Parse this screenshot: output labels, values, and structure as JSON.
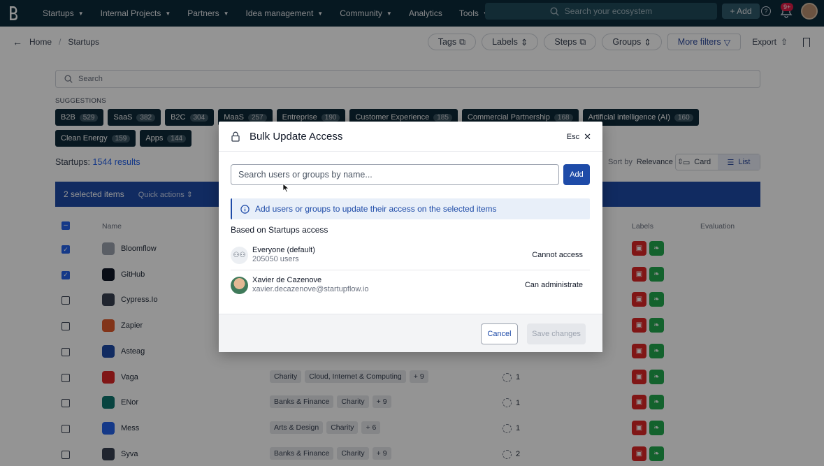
{
  "topnav": {
    "items": [
      "Startups",
      "Internal Projects",
      "Partners",
      "Idea management",
      "Community",
      "Analytics",
      "Tools"
    ],
    "search_placeholder": "Search your ecosystem",
    "add_label": "+ Add",
    "notif_badge": "9+"
  },
  "breadcrumb": {
    "home": "Home",
    "sep": "/",
    "current": "Startups"
  },
  "toolbar": {
    "tags": "Tags",
    "labels": "Labels",
    "steps": "Steps",
    "groups": "Groups",
    "more_filters": "More filters",
    "export": "Export"
  },
  "search": {
    "placeholder": "Search"
  },
  "suggestions": {
    "title": "SUGGESTIONS",
    "chips": [
      {
        "label": "B2B",
        "count": "529"
      },
      {
        "label": "SaaS",
        "count": "382"
      },
      {
        "label": "B2C",
        "count": "304"
      },
      {
        "label": "MaaS",
        "count": "257"
      },
      {
        "label": "Entreprise",
        "count": "190"
      },
      {
        "label": "Customer Experience",
        "count": "185"
      },
      {
        "label": "Commercial Partnership",
        "count": "168"
      },
      {
        "label": "Artificial intelligence (AI)",
        "count": "160"
      },
      {
        "label": "Clean Energy",
        "count": "159"
      },
      {
        "label": "Apps",
        "count": "144"
      }
    ]
  },
  "results": {
    "label": "Startups:",
    "count": "1544 results"
  },
  "sort": {
    "label": "Sort by",
    "value": "Relevance"
  },
  "view": {
    "card": "Card",
    "list": "List"
  },
  "selection": {
    "label": "2 selected items",
    "quick_actions": "Quick actions"
  },
  "table": {
    "headers": {
      "name": "Name",
      "labels": "Labels",
      "evaluation": "Evaluation"
    },
    "rows": [
      {
        "name": "Bloomflow",
        "checked": true,
        "tags": [],
        "more": "",
        "steps": ""
      },
      {
        "name": "GitHub",
        "checked": true,
        "tags": [],
        "more": "",
        "steps": ""
      },
      {
        "name": "Cypress.Io",
        "checked": false,
        "tags": [],
        "more": "",
        "steps": ""
      },
      {
        "name": "Zapier",
        "checked": false,
        "tags": [],
        "more": "",
        "steps": ""
      },
      {
        "name": "Asteag",
        "checked": false,
        "tags": [],
        "more": "",
        "steps": ""
      },
      {
        "name": "Vaga",
        "checked": false,
        "tags": [
          "Charity",
          "Cloud, Internet & Computing"
        ],
        "more": "+ 9",
        "steps": "1"
      },
      {
        "name": "ENor",
        "checked": false,
        "tags": [
          "Banks & Finance",
          "Charity"
        ],
        "more": "+ 9",
        "steps": "1"
      },
      {
        "name": "Mess",
        "checked": false,
        "tags": [
          "Arts & Design",
          "Charity"
        ],
        "more": "+ 6",
        "steps": "1"
      },
      {
        "name": "Syva",
        "checked": false,
        "tags": [
          "Banks & Finance",
          "Charity"
        ],
        "more": "+ 9",
        "steps": "2"
      }
    ]
  },
  "modal": {
    "title": "Bulk Update Access",
    "esc": "Esc",
    "search_placeholder": "Search users or groups by name...",
    "add": "Add",
    "info": "Add users or groups to update their access on the selected items",
    "based_on": "Based on Startups access",
    "users": [
      {
        "name": "Everyone (default)",
        "sub": "205050 users",
        "permission": "Cannot access"
      },
      {
        "name": "Xavier de Cazenove",
        "sub": "xavier.decazenove@startupflow.io",
        "permission": "Can administrate"
      }
    ],
    "cancel": "Cancel",
    "save": "Save changes"
  },
  "colors": {
    "navbar": "#0b2a3a",
    "accent": "#1e4ba8",
    "label_red": "#dc2626",
    "label_green": "#22a94f"
  }
}
